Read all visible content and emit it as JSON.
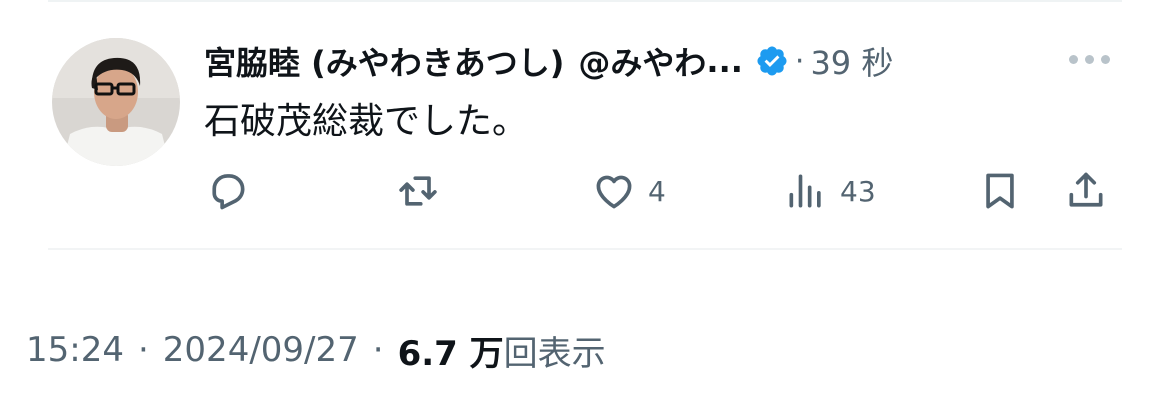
{
  "post": {
    "display_name": "宮脇睦 (みやわきあつし)",
    "handle": "@みやわ",
    "ellipsis": "...",
    "verified": true,
    "separator": "·",
    "relative_time": "39 秒",
    "text": "石破茂総裁でした。",
    "more_icon": "more-horizontal-icon"
  },
  "actions": {
    "reply": {
      "icon": "reply-icon"
    },
    "repost": {
      "icon": "repost-icon"
    },
    "like": {
      "icon": "heart-icon",
      "count": "4"
    },
    "views": {
      "icon": "analytics-icon",
      "count": "43"
    },
    "bookmark": {
      "icon": "bookmark-icon"
    },
    "share": {
      "icon": "share-icon"
    }
  },
  "meta": {
    "time": "15:24",
    "dot1": "·",
    "date": "2024/09/27",
    "dot2": "·",
    "views_count": "6.7 万",
    "views_label": "回表示"
  },
  "colors": {
    "text_primary": "#0f1419",
    "text_secondary": "#536471",
    "verified_blue": "#1d9bf0",
    "divider": "#eff3f4"
  }
}
